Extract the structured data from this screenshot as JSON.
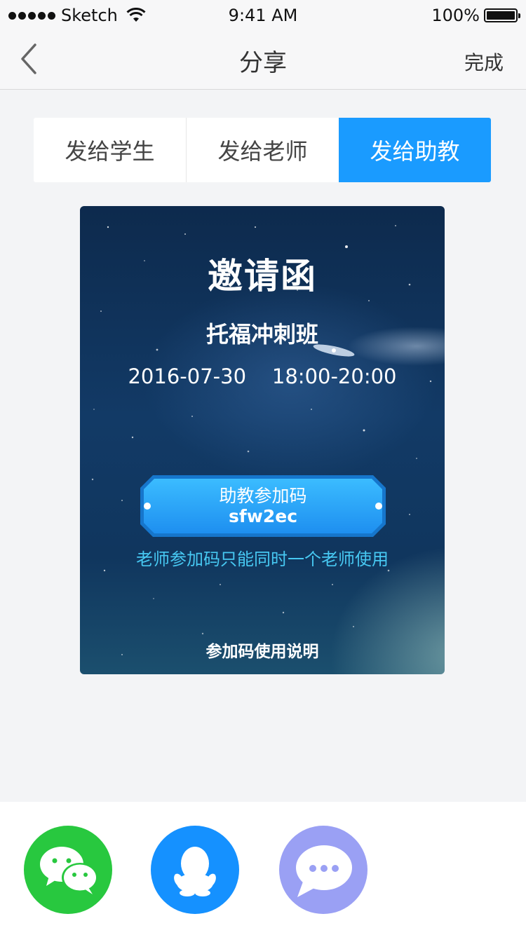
{
  "status_bar": {
    "carrier": "Sketch",
    "time": "9:41 AM",
    "battery": "100%"
  },
  "nav": {
    "title": "分享",
    "done_label": "完成"
  },
  "tabs": [
    {
      "label": "发给学生",
      "active": false
    },
    {
      "label": "发给老师",
      "active": false
    },
    {
      "label": "发给助教",
      "active": true
    }
  ],
  "card": {
    "title": "邀请函",
    "course": "托福冲刺班",
    "datetime": "2016-07-30    18:00-20:00",
    "code_label": "助教参加码",
    "code_value": "sfw2ec",
    "note": "老师参加码只能同时一个老师使用",
    "help_link": "参加码使用说明"
  },
  "share": {
    "icons": [
      "wechat-icon",
      "qq-icon",
      "message-icon"
    ]
  },
  "colors": {
    "accent": "#1a9bff",
    "wechat": "#28c83f",
    "qq": "#1591ff",
    "message": "#9aa0f4",
    "note_text": "#47c8f2"
  }
}
